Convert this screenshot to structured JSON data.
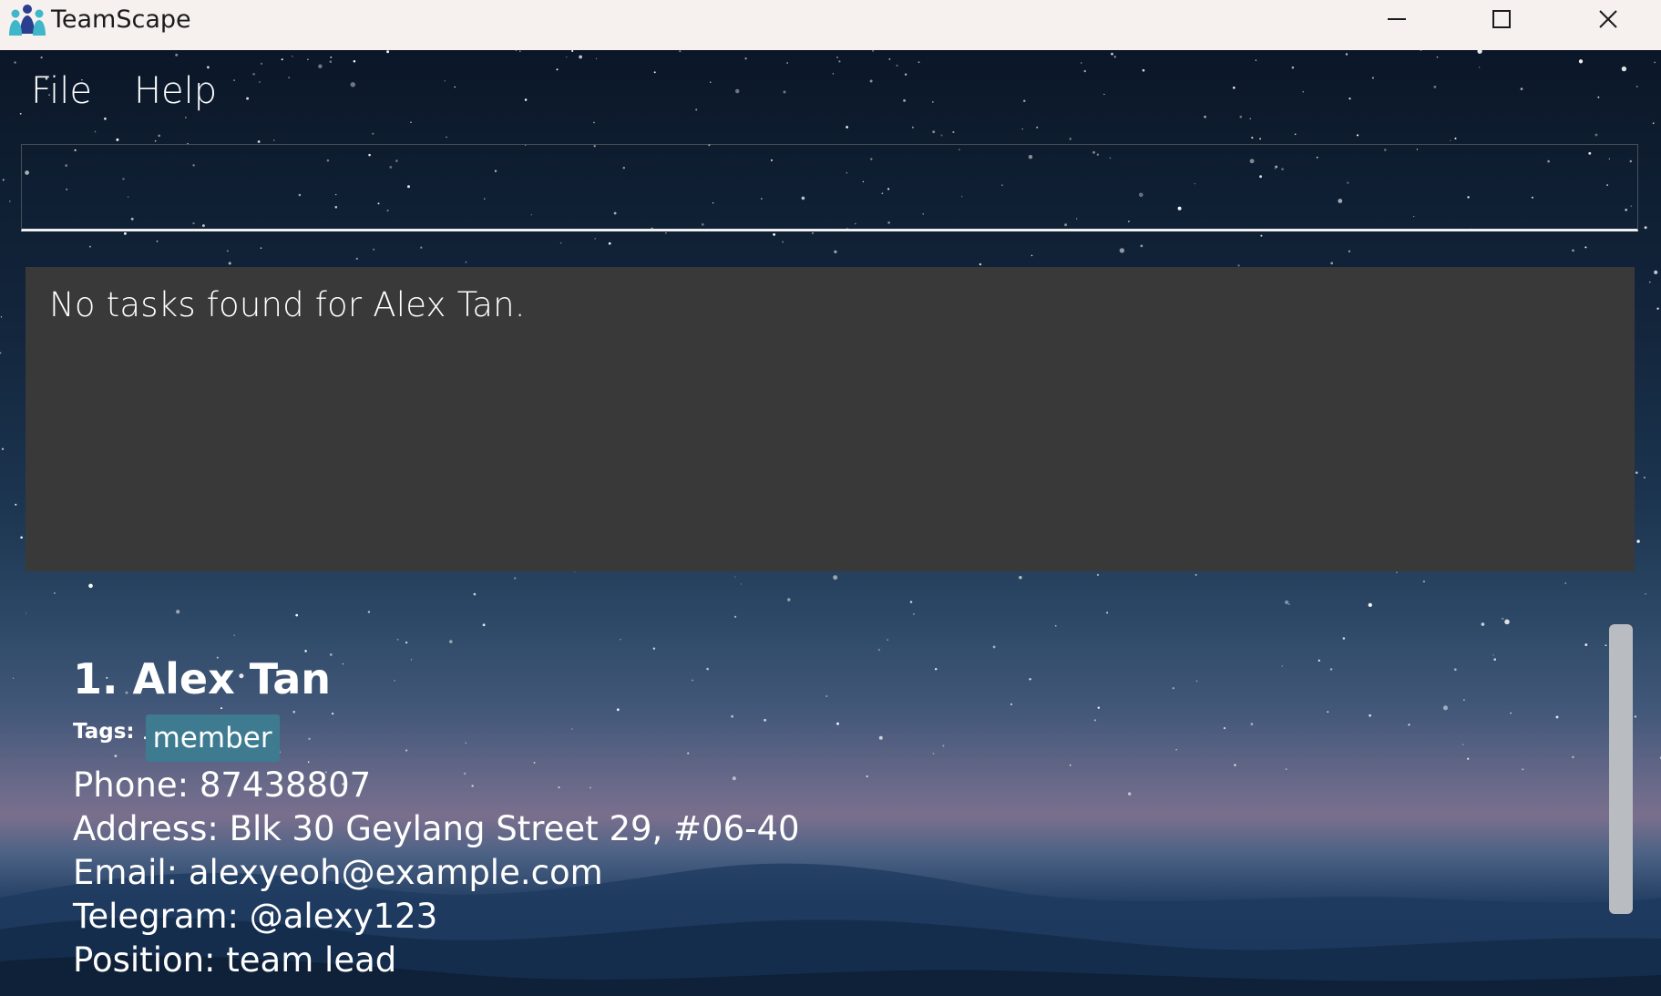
{
  "window": {
    "title": "TeamScape",
    "controls": {
      "minimize": "minimize-icon",
      "maximize": "maximize-icon",
      "close": "close-icon"
    }
  },
  "menu": {
    "items": [
      {
        "label": "File"
      },
      {
        "label": "Help"
      }
    ]
  },
  "command": {
    "value": "",
    "placeholder": ""
  },
  "result": {
    "message": "No tasks found for Alex Tan."
  },
  "person": {
    "header": "1. Alex Tan",
    "tags_label": "Tags:",
    "tags": [
      "member"
    ],
    "phone": "Phone: 87438807",
    "address": "Address: Blk 30 Geylang Street 29, #06-40",
    "email": "Email: alexyeoh@example.com",
    "telegram": "Telegram: @alexy123",
    "position": "Position: team lead"
  },
  "colors": {
    "titlebar": "#f6f1ee",
    "result_bg": "#393939",
    "tag_bg": "#3e7b91",
    "text": "#ffffff"
  }
}
